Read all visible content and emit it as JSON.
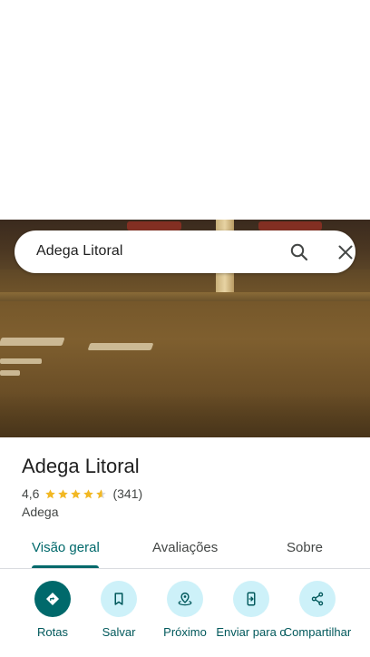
{
  "search": {
    "query": "Adega Litoral",
    "search_icon": "search-icon",
    "close_icon": "close-icon"
  },
  "place": {
    "name": "Adega Litoral",
    "rating": "4,6",
    "rating_value": 4.6,
    "review_count": "(341)",
    "category": "Adega"
  },
  "tabs": [
    {
      "label": "Visão geral",
      "active": true
    },
    {
      "label": "Avaliações",
      "active": false
    },
    {
      "label": "Sobre",
      "active": false
    }
  ],
  "actions": [
    {
      "label": "Rotas",
      "icon": "directions-icon"
    },
    {
      "label": "Salvar",
      "icon": "bookmark-icon"
    },
    {
      "label": "Próximo",
      "icon": "nearby-icon"
    },
    {
      "label": "Enviar para o",
      "icon": "send-to-phone-icon"
    },
    {
      "label": "Compartilhar",
      "icon": "share-icon"
    }
  ],
  "colors": {
    "accent": "#00696b",
    "action_bg": "#cdf1f9",
    "star": "#f2b824"
  }
}
